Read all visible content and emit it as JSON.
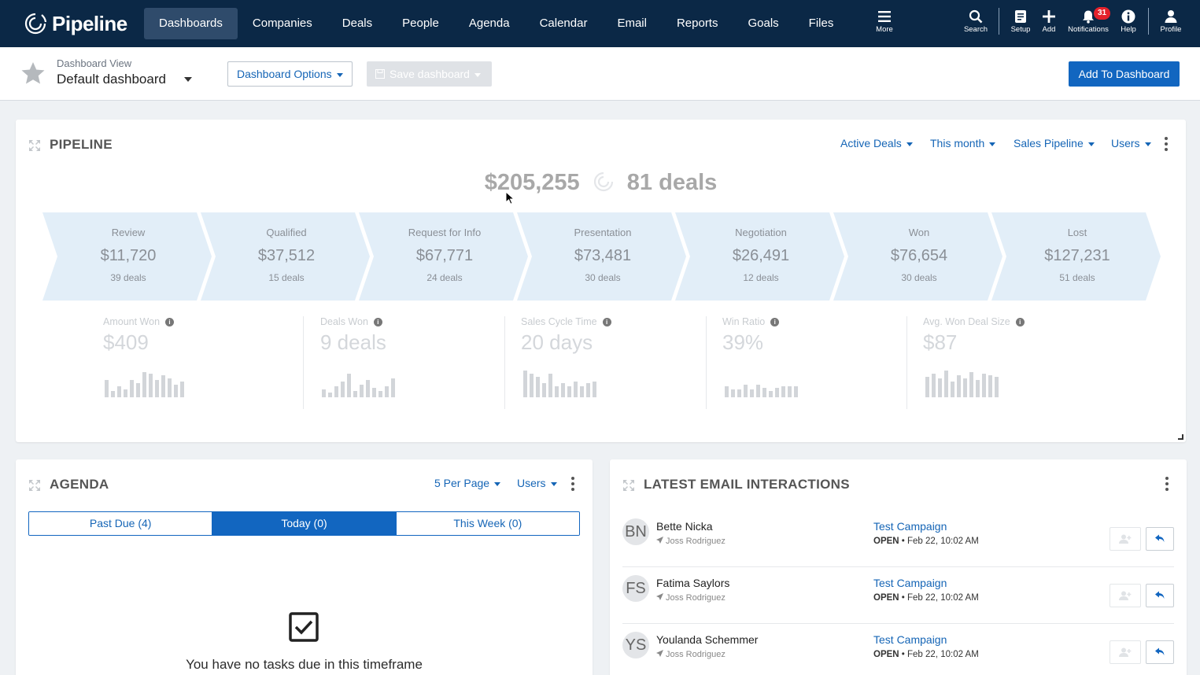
{
  "nav": {
    "logo": "Pipeline",
    "links": [
      {
        "label": "Dashboards",
        "active": true
      },
      {
        "label": "Companies"
      },
      {
        "label": "Deals"
      },
      {
        "label": "People"
      },
      {
        "label": "Agenda"
      },
      {
        "label": "Calendar"
      },
      {
        "label": "Email"
      },
      {
        "label": "Reports"
      },
      {
        "label": "Goals"
      },
      {
        "label": "Files"
      }
    ],
    "more_label": "More",
    "search_label": "Search",
    "setup_label": "Setup",
    "add_label": "Add",
    "notifications_label": "Notifications",
    "notifications_count": "31",
    "help_label": "Help",
    "profile_label": "Profile"
  },
  "subheader": {
    "view_label": "Dashboard View",
    "view_value": "Default dashboard",
    "options_label": "Dashboard Options",
    "save_label": "Save dashboard",
    "add_label": "Add To Dashboard"
  },
  "pipeline": {
    "title": "PIPELINE",
    "filters": [
      "Active Deals",
      "This month",
      "Sales Pipeline",
      "Users"
    ],
    "total_amount": "$205,255",
    "total_deals": "81 deals",
    "stages": [
      {
        "name": "Review",
        "amount": "$11,720",
        "deals": "39 deals"
      },
      {
        "name": "Qualified",
        "amount": "$37,512",
        "deals": "15 deals"
      },
      {
        "name": "Request for Info",
        "amount": "$67,771",
        "deals": "24 deals"
      },
      {
        "name": "Presentation",
        "amount": "$73,481",
        "deals": "30 deals"
      },
      {
        "name": "Negotiation",
        "amount": "$26,491",
        "deals": "12 deals"
      },
      {
        "name": "Won",
        "amount": "$76,654",
        "deals": "30 deals"
      },
      {
        "name": "Lost",
        "amount": "$127,231",
        "deals": "51 deals"
      }
    ],
    "metrics": [
      {
        "label": "Amount Won",
        "value": "$409"
      },
      {
        "label": "Deals Won",
        "value": "9 deals"
      },
      {
        "label": "Sales Cycle Time",
        "value": "20 days"
      },
      {
        "label": "Win Ratio",
        "value": "39%"
      },
      {
        "label": "Avg. Won Deal Size",
        "value": "$87"
      }
    ]
  },
  "agenda": {
    "title": "AGENDA",
    "per_page": "5 Per Page",
    "users": "Users",
    "tabs": [
      {
        "label": "Past Due (4)"
      },
      {
        "label": "Today (0)",
        "active": true
      },
      {
        "label": "This Week (0)"
      }
    ],
    "empty_message": "You have no tasks due in this timeframe"
  },
  "emails": {
    "title": "LATEST EMAIL INTERACTIONS",
    "rows": [
      {
        "initials": "BN",
        "name": "Bette Nicka",
        "by": "Joss Rodriguez",
        "campaign": "Test Campaign",
        "status": "OPEN",
        "date": "Feb 22, 10:02 AM"
      },
      {
        "initials": "FS",
        "name": "Fatima Saylors",
        "by": "Joss Rodriguez",
        "campaign": "Test Campaign",
        "status": "OPEN",
        "date": "Feb 22, 10:02 AM"
      },
      {
        "initials": "YS",
        "name": "Youlanda Schemmer",
        "by": "Joss Rodriguez",
        "campaign": "Test Campaign",
        "status": "OPEN",
        "date": "Feb 22, 10:02 AM"
      }
    ]
  },
  "colors": {
    "nav_bg": "#0b2846",
    "accent": "#1266c0",
    "stage_fill": "#e2eef8",
    "badge": "#e4222b"
  }
}
